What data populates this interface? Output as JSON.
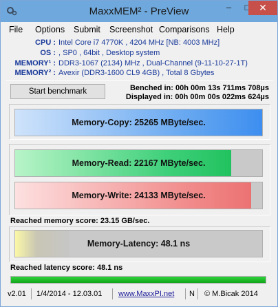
{
  "window": {
    "title": "MaxxMEM² - PreView",
    "minimize": "–",
    "maximize": "□",
    "close": "✕"
  },
  "menu": [
    "File",
    "Options",
    "Submit",
    "Screenshot",
    "Comparisons",
    "Help"
  ],
  "system_info": [
    {
      "label": "CPU :",
      "value": "Intel Core i7 4770K , 4204 MHz [NB: 4003 MHz]"
    },
    {
      "label": "OS :",
      "value": ", SP0 , 64bit , Desktop system"
    },
    {
      "label": "MEMORY¹ :",
      "value": "DDR3-1067 (2134) MHz , Dual-Channel (9-11-10-27-1T)"
    },
    {
      "label": "MEMORY² :",
      "value": "Avexir (DDR3-1600 CL9 4GB) , Total 8 Gbytes"
    }
  ],
  "benchmark": {
    "start_label": "Start benchmark",
    "benched": "Benched in: 00h 00m 13s 711ms 708µs",
    "displayed": "Displayed in: 00h 00m 00s 022ms 624µs"
  },
  "results": {
    "copy": {
      "label": "Memory-Copy: 25265 MByte/sec.",
      "fill": 1.0
    },
    "read": {
      "label": "Memory-Read: 22167 MByte/sec.",
      "fill": 0.875
    },
    "write": {
      "label": "Memory-Write: 24133 MByte/sec.",
      "fill": 0.955
    },
    "memory_score": "Reached memory score: 23.15 GB/sec.",
    "latency": {
      "label": "Memory-Latency: 48.1 ns",
      "fill": 0.22
    },
    "latency_score": "Reached latency score: 48.1 ns"
  },
  "progress": {
    "fill": 1.0
  },
  "status": {
    "version": "v2.01",
    "date": "1/4/2014 - 12.03.01",
    "link": "www.MaxxPI.net",
    "flag": "N",
    "copyright": "© M.Bicak 2014"
  },
  "colors": {
    "titlebar": "#6fa8dc",
    "info_text": "#1a3a9a",
    "progress": "#11a51c"
  }
}
